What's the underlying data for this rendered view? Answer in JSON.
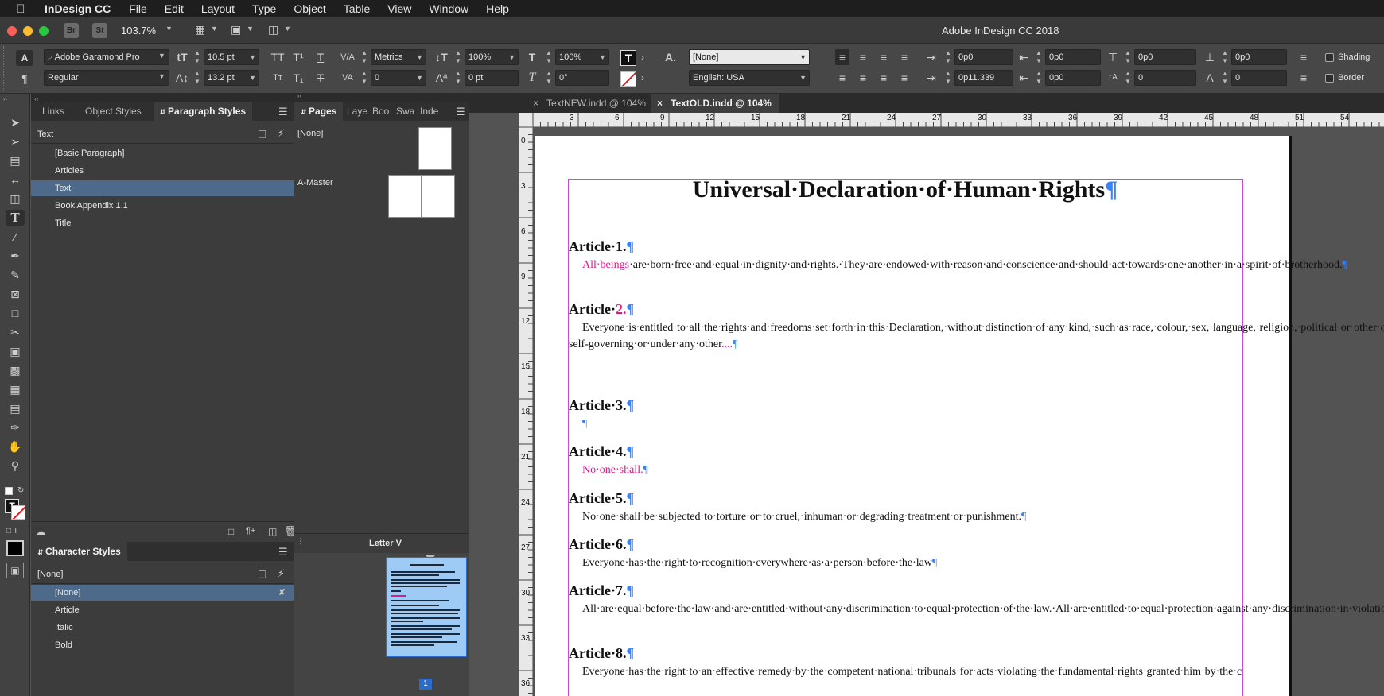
{
  "menubar": {
    "app": "InDesign CC",
    "items": [
      "File",
      "Edit",
      "Layout",
      "Type",
      "Object",
      "Table",
      "View",
      "Window",
      "Help"
    ]
  },
  "appbar": {
    "zoom": "103.7%",
    "title": "Adobe InDesign CC 2018",
    "bridge": "Br",
    "stock": "St"
  },
  "control": {
    "font_family": "Adobe Garamond Pro",
    "font_style": "Regular",
    "font_size": "10.5 pt",
    "leading": "13.2 pt",
    "kerning": "Metrics",
    "tracking": "0",
    "vscale": "100%",
    "hscale": "100%",
    "baseline": "0 pt",
    "skew": "0°",
    "para_style": "[None]",
    "language": "English: USA",
    "left_indent": "0p0",
    "first_indent": "0p11.339",
    "right_indent": "0p0",
    "last_indent": "0p0",
    "space_before": "0p0",
    "space_after": "0p0",
    "drop_lines": "0",
    "drop_chars": "0",
    "shading": "Shading",
    "border": "Border"
  },
  "styles_panel": {
    "tabs": [
      "Links",
      "Object Styles",
      "Paragraph Styles"
    ],
    "current": "Text",
    "items": [
      "[Basic Paragraph]",
      "Articles",
      "Text",
      "Book Appendix 1.1",
      "Title"
    ],
    "selected": 2
  },
  "char_panel": {
    "tab": "Character Styles",
    "current": "[None]",
    "items": [
      "[None]",
      "Article",
      "Italic",
      "Bold"
    ],
    "selected": 0
  },
  "pages_panel": {
    "tabs": [
      "Pages",
      "Laye",
      "Boo",
      "Swa",
      "Inde"
    ],
    "none_label": "[None]",
    "master_label": "A-Master",
    "letter_label": "Letter V",
    "page_number": "1"
  },
  "doc_tabs": [
    {
      "label": "TextNEW.indd @ 104%"
    },
    {
      "label": "TextOLD.indd @ 104%"
    }
  ],
  "ruler": {
    "h": [
      "3",
      "6",
      "9",
      "12",
      "15",
      "18",
      "21",
      "24",
      "27",
      "30",
      "33",
      "36",
      "39",
      "42",
      "45",
      "48",
      "51",
      "54"
    ],
    "v": [
      "0",
      "3",
      "6",
      "9",
      "12",
      "15",
      "18",
      "21",
      "24",
      "27",
      "30",
      "33",
      "36"
    ]
  },
  "document": {
    "title": "Universal·Declaration·of·Human·Rights",
    "pilcrow": "¶",
    "a1": "Article·1.",
    "a1_mag": "All·beings",
    "a1_rest": "·are·born·free·and·equal·in·dignity·and·rights.·They·are·endowed·with·reason·and·conscience·and·should·act·towards·one·another·in·a·spirit·of·brotherhood.",
    "a2": "Article·",
    "a2_num": "2.",
    "a2_text": "Everyone·is·entitled·to·all·the·rights·and·freedoms·set·forth·in·this·Declaration,·without·distinction·of·any·kind,·such·as·race,·colour,·sex,·language,·religion,·political·or·other·opinion,·national·or·social·origin,·property,·birth·or·other·status.·Furthermore,·no·distinction·shall·be·made·on·the·basis·of·the·political,·jurisdictional·or·international·status·of·the·country·or·territory·to·which·a·person·belongs,·whether·it·be·independent,·trust,·non-self-governing·or·under·any·other",
    "a2_dots": "....",
    "a3": "Article·3.",
    "a4": "Article·4.",
    "a4_mag": "No·one·shall.",
    "a5": "Article·5.",
    "a5_text": "No·one·shall·be·subjected·to·torture·or·to·cruel,·inhuman·or·degrading·treatment·or·punishment.",
    "a6": "Article·6.",
    "a6_text": "Everyone·has·the·right·to·recognition·everywhere·as·a·person·before·the·law",
    "a7": "Article·7.",
    "a7_text": "All·are·equal·before·the·law·and·are·entitled·without·any·discrimination·to·equal·protection·of·the·law.·All·are·entitled·to·equal·protection·against·any·discrimination·in·violation·of·this·Declaration·and·against·any·incitement·to·such·discrimination.",
    "a8": "Article·8.",
    "a8_text": "Everyone·has·the·right·to·an·effective·remedy·by·the·competent·national·tribunals·for·acts·violating·the·fundamental·rights·granted·him·by·the·constitution·or·by·law."
  },
  "colors": {
    "accent": "#4e6a8a",
    "magenta": "#e0168a",
    "pilcrow": "#3b82f6",
    "frame": "#c94ad3"
  }
}
